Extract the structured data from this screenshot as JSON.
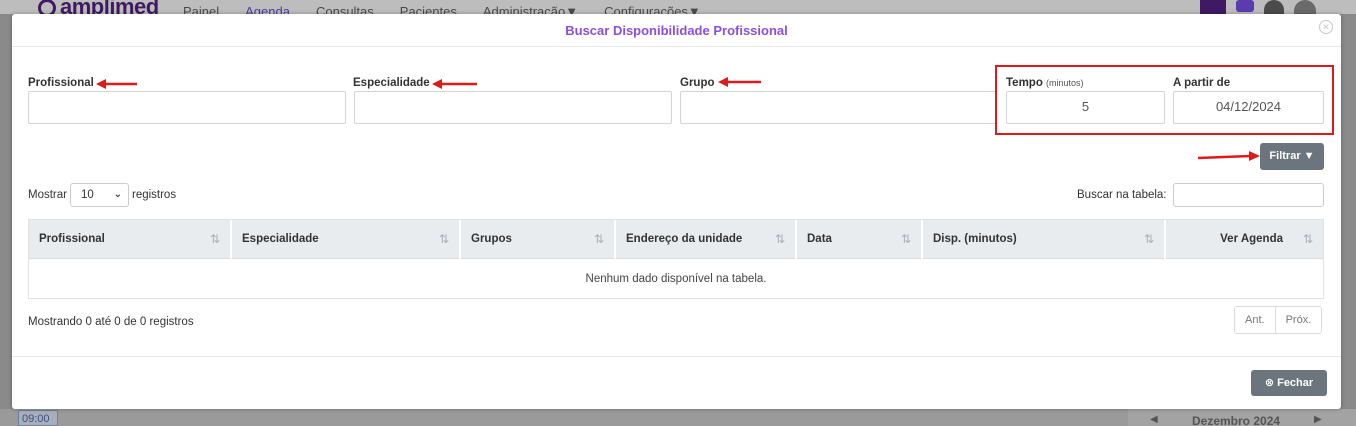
{
  "background": {
    "logo": "amplimed",
    "menu": [
      "Painel",
      "Agenda",
      "Consultas",
      "Pacientes",
      "Administração▼",
      "Configurações▼"
    ],
    "time_slot": "09:00",
    "calendar_month": "Dezembro 2024"
  },
  "modal": {
    "title": "Buscar Disponibilidade Profissional",
    "fields": {
      "profissional_label": "Profissional",
      "profissional_value": "",
      "especialidade_label": "Especialidade",
      "especialidade_value": "",
      "grupo_label": "Grupo",
      "grupo_value": "",
      "tempo_label": "Tempo",
      "tempo_unit": "(minutos)",
      "tempo_value": "5",
      "a_partir_label": "A partir de",
      "a_partir_value": "04/12/2024"
    },
    "filter_button": "Filtrar",
    "show": {
      "prefix": "Mostrar",
      "selected": "10",
      "suffix": "registros"
    },
    "search_label": "Buscar na tabela:",
    "table": {
      "columns": [
        "Profissional",
        "Especialidade",
        "Grupos",
        "Endereço da unidade",
        "Data",
        "Disp. (minutos)",
        "Ver Agenda"
      ],
      "empty_message": "Nenhum dado disponível na tabela."
    },
    "info": "Mostrando 0 até 0 de 0 registros",
    "pagination": {
      "prev": "Ant.",
      "next": "Próx."
    },
    "close_button": "Fechar"
  },
  "colors": {
    "title": "#8a4fe0",
    "highlight": "#e01a1a",
    "button": "#6c757d"
  }
}
